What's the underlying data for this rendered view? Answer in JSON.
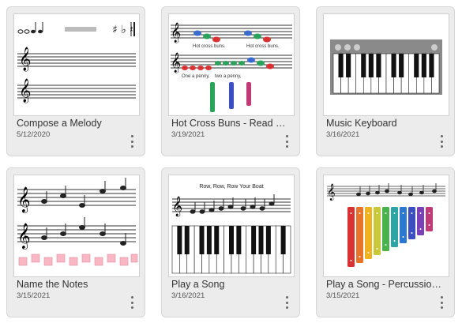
{
  "cards": [
    {
      "title": "Compose a Melody",
      "date": "5/12/2020"
    },
    {
      "title": "Hot Cross Buns - Read and Play",
      "date": "3/19/2021",
      "thumb_text": [
        "Hot cross buns.",
        "Hot cross buns.",
        "One a penny,",
        "two a penny,"
      ]
    },
    {
      "title": "Music Keyboard",
      "date": "3/16/2021"
    },
    {
      "title": "Name the Notes",
      "date": "3/15/2021"
    },
    {
      "title": "Play a Song",
      "date": "3/16/2021",
      "thumb_text": [
        "Row, Row, Row Your Boat"
      ]
    },
    {
      "title": "Play a Song - Percussion Instrument",
      "date": "3/15/2021"
    }
  ],
  "colors": {
    "card_bg": "#ececec",
    "keyboard_frame": "#888888",
    "bars": [
      "#d93232",
      "#e8742a",
      "#f0b21e",
      "#c8c83a",
      "#4ab24a",
      "#2da5a5",
      "#2a78d0",
      "#3b4fc2",
      "#7b3fb8",
      "#c03a78"
    ]
  },
  "icons": [
    "more-vert-icon",
    "treble-clef-icon"
  ]
}
